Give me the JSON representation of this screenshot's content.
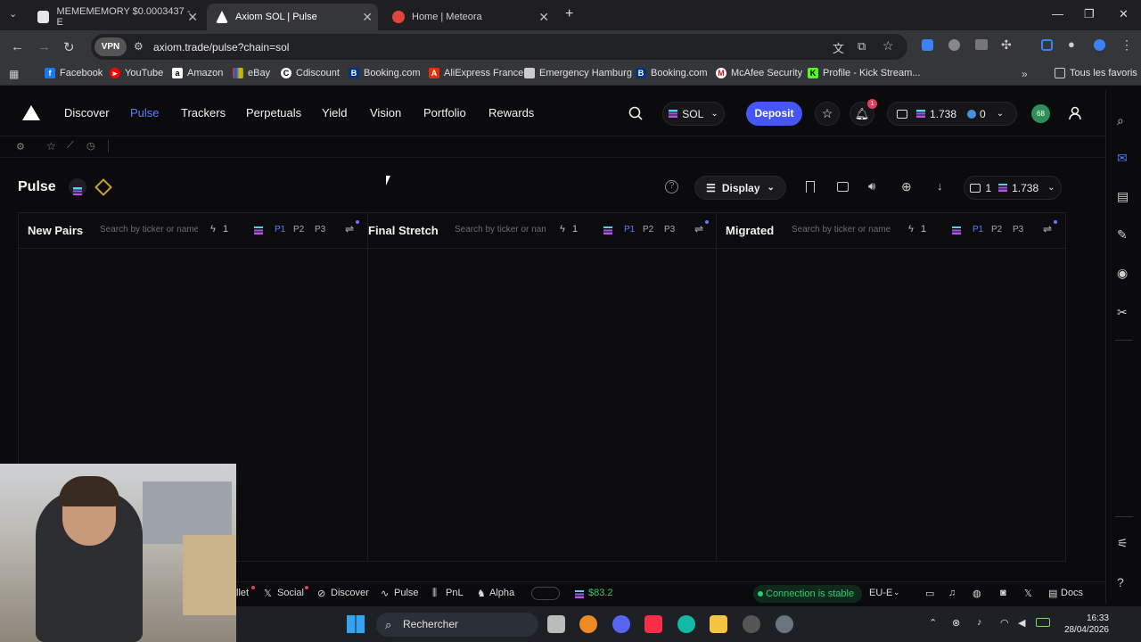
{
  "browser": {
    "tabs": [
      {
        "title": "MEMEMEMORY $0.0003437 - E",
        "favicon_color": "#e5e5e5"
      },
      {
        "title": "Axiom SOL | Pulse",
        "favicon_color": "#ffffff"
      },
      {
        "title": "Home | Meteora",
        "favicon_color": "#e0453a"
      }
    ],
    "new_tab": "+",
    "url": "axiom.trade/pulse?chain=sol",
    "vpn_label": "VPN",
    "bookmarks": [
      {
        "label": "Facebook",
        "icon_color": "#1877f2"
      },
      {
        "label": "YouTube",
        "icon_color": "#ff0000"
      },
      {
        "label": "Amazon",
        "icon_color": "#ffffff"
      },
      {
        "label": "eBay",
        "icon_color": "#e53238"
      },
      {
        "label": "Cdiscount",
        "icon_color": "#ffffff"
      },
      {
        "label": "Booking.com",
        "icon_color": "#003580"
      },
      {
        "label": "AliExpress France",
        "icon_color": "#e62e04"
      },
      {
        "label": "Emergency Hamburg",
        "icon_color": "#cccccc"
      },
      {
        "label": "Booking.com",
        "icon_color": "#003580"
      },
      {
        "label": "McAfee Security",
        "icon_color": "#ffffff"
      },
      {
        "label": "Profile - Kick Stream...",
        "icon_color": "#53fc18"
      }
    ],
    "all_bookmarks": "Tous les favoris"
  },
  "app": {
    "nav": [
      "Discover",
      "Pulse",
      "Trackers",
      "Perpetuals",
      "Yield",
      "Vision",
      "Portfolio",
      "Rewards"
    ],
    "active_nav": "Pulse",
    "chain_selector": "SOL",
    "deposit_label": "Deposit",
    "notification_count": "1",
    "wallet_balance": "1.738",
    "wallet_secondary": "0",
    "avatar_text": "68",
    "page_title": "Pulse",
    "display_label": "Display",
    "wallet_count": "1",
    "wallet_dropdown_balance": "1.738",
    "accent": "#5b7cff",
    "deposit_color": "#4656f5"
  },
  "columns": [
    {
      "title": "New Pairs",
      "search_placeholder": "Search by ticker or name",
      "bolt_value": "1",
      "presets": [
        "P1",
        "P2",
        "P3"
      ],
      "active_preset": "P1"
    },
    {
      "title": "Final Stretch",
      "search_placeholder": "Search by ticker or name",
      "bolt_value": "1",
      "presets": [
        "P1",
        "P2",
        "P3"
      ],
      "active_preset": "P1"
    },
    {
      "title": "Migrated",
      "search_placeholder": "Search by ticker or name",
      "bolt_value": "1",
      "presets": [
        "P1",
        "P2",
        "P3"
      ],
      "active_preset": "P1"
    }
  ],
  "footer": {
    "wallet_partial": "llet",
    "items": [
      "Social",
      "Discover",
      "Pulse",
      "PnL",
      "Alpha"
    ],
    "sol_price": "$83.2",
    "connection": "Connection is stable",
    "region": "EU-E",
    "docs": "Docs"
  },
  "taskbar": {
    "search_label": "Rechercher",
    "time": "16:33",
    "date": "28/04/2026"
  }
}
